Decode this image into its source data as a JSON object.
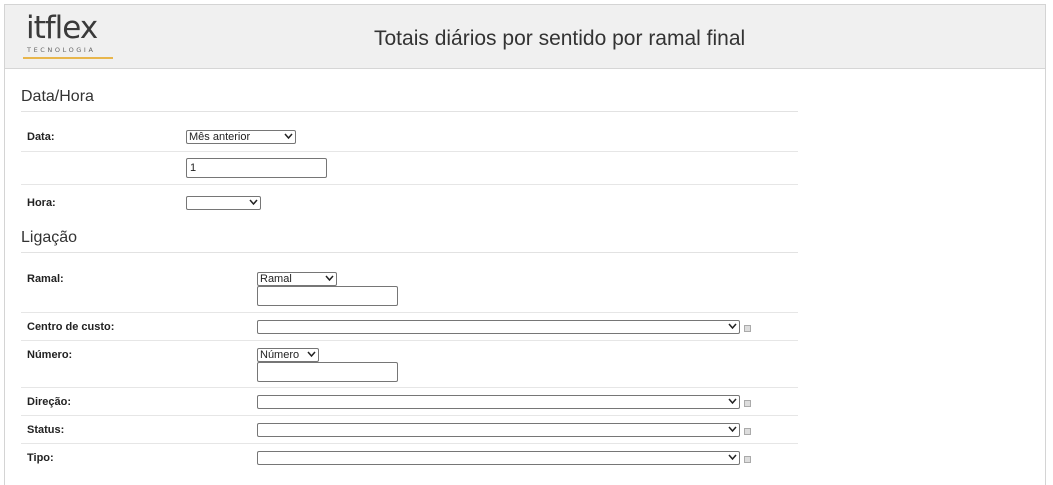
{
  "header": {
    "logo_text": "itflex",
    "logo_sub": "TECNOLOGIA",
    "title": "Totais diários por sentido por ramal final"
  },
  "sections": {
    "datahora": "Data/Hora",
    "ligacao": "Ligação"
  },
  "form": {
    "data_label": "Data:",
    "data_select": "Mês anterior",
    "data_input": "1",
    "hora_label": "Hora:",
    "hora_select": "",
    "ramal_label": "Ramal:",
    "ramal_select": "Ramal",
    "ramal_input": "",
    "centro_label": "Centro de custo:",
    "centro_select": "",
    "numero_label": "Número:",
    "numero_select": "Número",
    "numero_input": "",
    "direcao_label": "Direção:",
    "direcao_select": "",
    "status_label": "Status:",
    "status_select": "",
    "tipo_label": "Tipo:",
    "tipo_select": ""
  }
}
